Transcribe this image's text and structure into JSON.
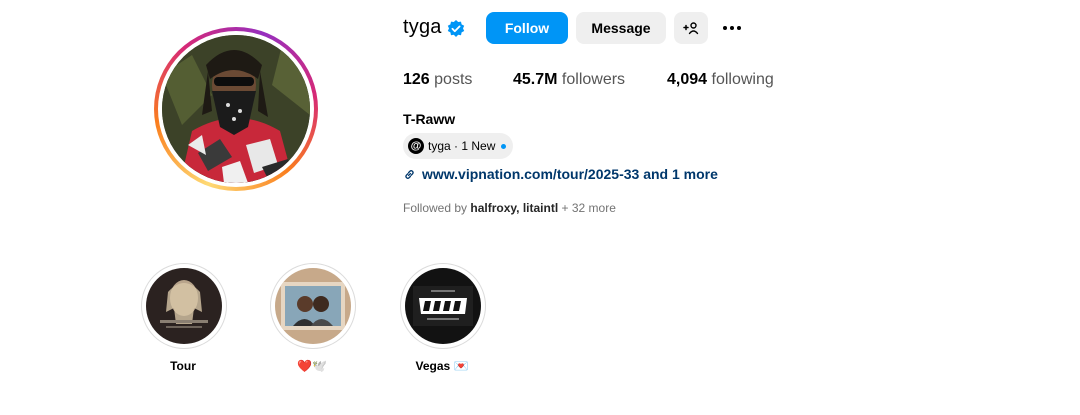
{
  "profile": {
    "username": "tyga",
    "verified_icon": "verified-badge-icon",
    "follow_label": "Follow",
    "message_label": "Message",
    "adduser_label": "+👤",
    "more_icon": "more-options-icon",
    "full_name": "T-Raww"
  },
  "stats": {
    "posts_count": "126",
    "posts_label": "posts",
    "followers_count": "45.7M",
    "followers_label": "followers",
    "following_count": "4,094",
    "following_label": "following"
  },
  "threads": {
    "icon": "threads-icon",
    "text": "tyga · 1 New"
  },
  "link": {
    "icon": "link-icon",
    "text": "www.vipnation.com/tour/2025-33 and 1 more"
  },
  "followed_by": {
    "prefix": "Followed by",
    "users": "halfroxy, litaintl",
    "suffix": "+ 32 more"
  },
  "highlights": [
    {
      "label": "Tour"
    },
    {
      "label": "❤️🕊️"
    },
    {
      "label": "Vegas 💌"
    }
  ],
  "colors": {
    "accent": "#0095f6",
    "link": "#00376b",
    "secondary_button": "#efefef"
  }
}
